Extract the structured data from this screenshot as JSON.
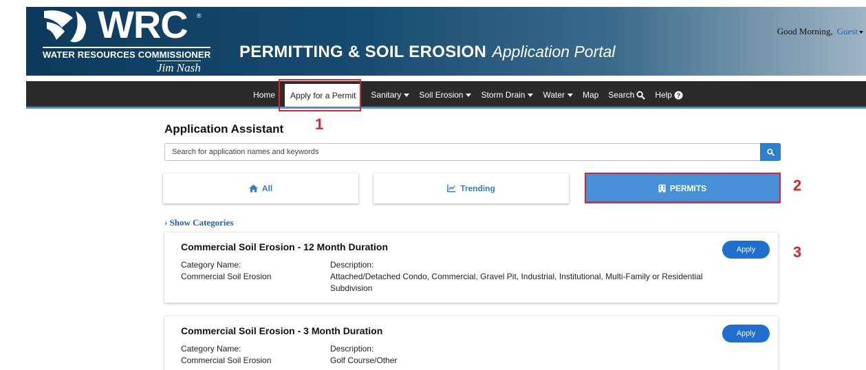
{
  "header": {
    "logo_text": "WRC",
    "logo_reg": "®",
    "logo_subtitle": "WATER RESOURCES COMMISSIONER",
    "logo_name": "Jim Nash",
    "portal_title_bold": "PERMITTING & SOIL EROSION",
    "portal_title_italic": "Application Portal",
    "greeting": "Good Morning,",
    "user": "Guest",
    "brand_color": "#0d3a5c"
  },
  "nav": {
    "items": [
      {
        "label": "Home"
      },
      {
        "label": "Apply for a Permit"
      },
      {
        "label": "Sanitary"
      },
      {
        "label": "Soil Erosion"
      },
      {
        "label": "Storm Drain"
      },
      {
        "label": "Water"
      },
      {
        "label": "Map"
      },
      {
        "label": "Search"
      },
      {
        "label": "Help"
      }
    ]
  },
  "annotations": {
    "marker1": "1",
    "marker2": "2",
    "marker3": "3",
    "color": "#e0242a"
  },
  "assistant": {
    "title": "Application Assistant",
    "search_placeholder": "Search for application names and keywords",
    "filters": {
      "all": "All",
      "trending": "Trending",
      "permits": "PERMITS"
    },
    "show_categories": "› Show Categories"
  },
  "cards": [
    {
      "title": "Commercial Soil Erosion - 12 Month Duration",
      "category_label": "Category Name:",
      "category_value": "Commercial Soil Erosion",
      "description_label": "Description:",
      "description_value": "Attached/Detached Condo, Commercial, Gravel Pit, Industrial, Institutional, Multi-Family or Residential Subdivision",
      "apply_label": "Apply"
    },
    {
      "title": "Commercial Soil Erosion - 3 Month Duration",
      "category_label": "Category Name:",
      "category_value": "Commercial Soil Erosion",
      "description_label": "Description:",
      "description_value": "Golf Course/Other",
      "apply_label": "Apply"
    }
  ]
}
